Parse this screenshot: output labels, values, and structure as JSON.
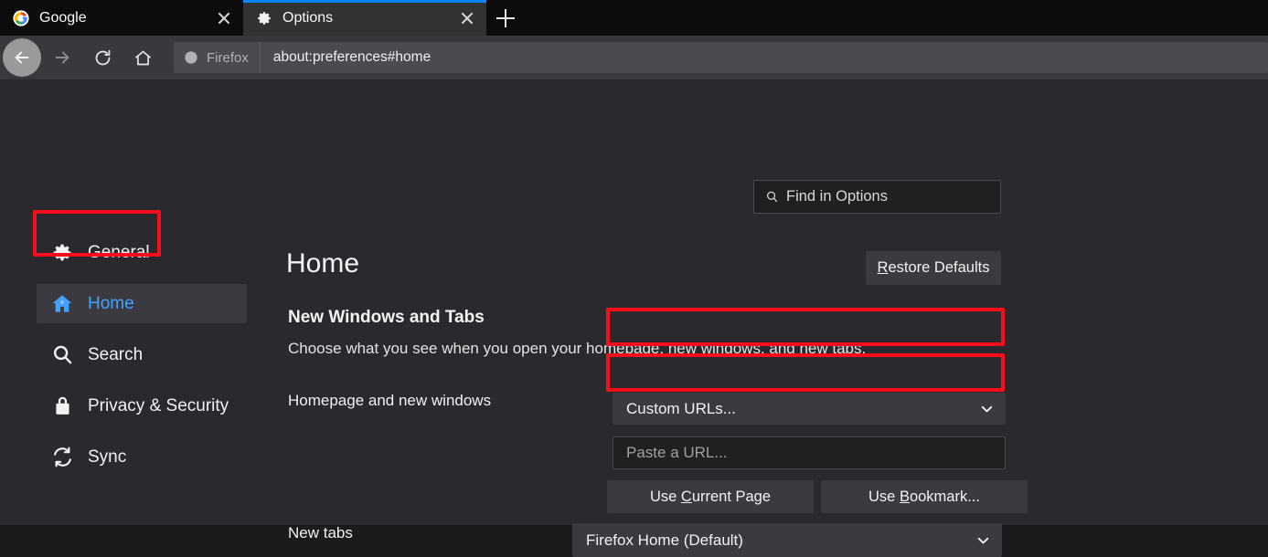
{
  "window": {
    "tabs": [
      {
        "title": "Google",
        "favicon": "google-favicon",
        "active": false,
        "close_label": "x"
      },
      {
        "title": "Options",
        "favicon": "gear-icon",
        "active": true,
        "close_label": "x"
      }
    ],
    "new_tab_label": "+"
  },
  "toolbar": {
    "back_label": "Back",
    "forward_label": "Forward",
    "reload_label": "Reload",
    "home_label": "Home",
    "identity_label": "Firefox",
    "url": "about:preferences#home"
  },
  "search": {
    "placeholder": "Find in Options",
    "icon": "search-icon"
  },
  "sidebar": {
    "items": [
      {
        "label": "General",
        "icon": "gear-icon",
        "selected": false
      },
      {
        "label": "Home",
        "icon": "home-icon",
        "selected": true
      },
      {
        "label": "Search",
        "icon": "search-icon",
        "selected": false
      },
      {
        "label": "Privacy & Security",
        "icon": "lock-icon",
        "selected": false
      },
      {
        "label": "Sync",
        "icon": "sync-icon",
        "selected": false
      }
    ]
  },
  "main": {
    "page_title": "Home",
    "restore_defaults": {
      "prefix": "",
      "key": "R",
      "rest": "estore Defaults"
    },
    "section_title": "New Windows and Tabs",
    "section_desc": "Choose what you see when you open your homepage, new windows, and new tabs.",
    "homepage_row": {
      "label": "Homepage and new windows",
      "select_value": "Custom URLs..."
    },
    "url_input": {
      "placeholder": "Paste a URL...",
      "value": ""
    },
    "buttons": {
      "use_current_page": {
        "pre": "Use ",
        "key": "C",
        "post": "urrent Page"
      },
      "use_bookmark": {
        "pre": "Use ",
        "key": "B",
        "post": "ookmark..."
      }
    },
    "newtabs_row": {
      "label": "New tabs",
      "select_value": "Firefox Home (Default)"
    }
  },
  "annotations": {
    "color": "#fc0d1b",
    "targets": [
      "sidebar-item-home",
      "homepage-select",
      "homepage-url-input"
    ]
  },
  "colors": {
    "accent": "#0a84ff",
    "selected_text": "#45a1ff",
    "tab_active_bg": "#323234",
    "chrome_bg": "#38383d",
    "content_bg": "#2a2a2e",
    "field_bg": "#202023",
    "button_bg": "#3b3b3f"
  }
}
